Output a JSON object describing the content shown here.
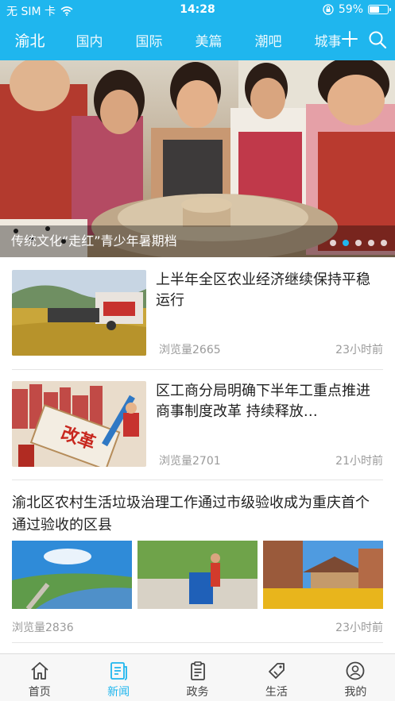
{
  "status_bar": {
    "carrier": "无 SIM 卡",
    "time": "14:28",
    "battery_percent": "59%",
    "battery_level": 0.59
  },
  "nav": {
    "tabs": [
      {
        "label": "渝北"
      },
      {
        "label": "国内"
      },
      {
        "label": "国际"
      },
      {
        "label": "美篇"
      },
      {
        "label": "潮吧"
      },
      {
        "label": "城事"
      }
    ],
    "active_tab": 0
  },
  "banner": {
    "caption": "传统文化“走红”青少年暑期档",
    "slide_count": 5,
    "active_slide": 1
  },
  "articles": [
    {
      "title": "上半年全区农业经济继续保持平稳运行",
      "views": "浏览量2665",
      "time": "23小时前"
    },
    {
      "title": "区工商分局明确下半年工重点推进商事制度改革 持续释放…",
      "views": "浏览量2701",
      "time": "21小时前",
      "image_text": "改革"
    },
    {
      "title": "渝北区农村生活垃圾治理工作通过市级验收成为重庆首个通过验收的区县",
      "views": "浏览量2836",
      "time": "23小时前"
    }
  ],
  "tabbar": {
    "items": [
      {
        "label": "首页",
        "icon": "home-icon"
      },
      {
        "label": "新闻",
        "icon": "news-icon"
      },
      {
        "label": "政务",
        "icon": "clipboard-icon"
      },
      {
        "label": "生活",
        "icon": "tag-icon"
      },
      {
        "label": "我的",
        "icon": "user-icon"
      }
    ],
    "active": 1
  },
  "colors": {
    "brand": "#1fb6ee",
    "text": "#222222",
    "meta": "#9a9a9a"
  }
}
